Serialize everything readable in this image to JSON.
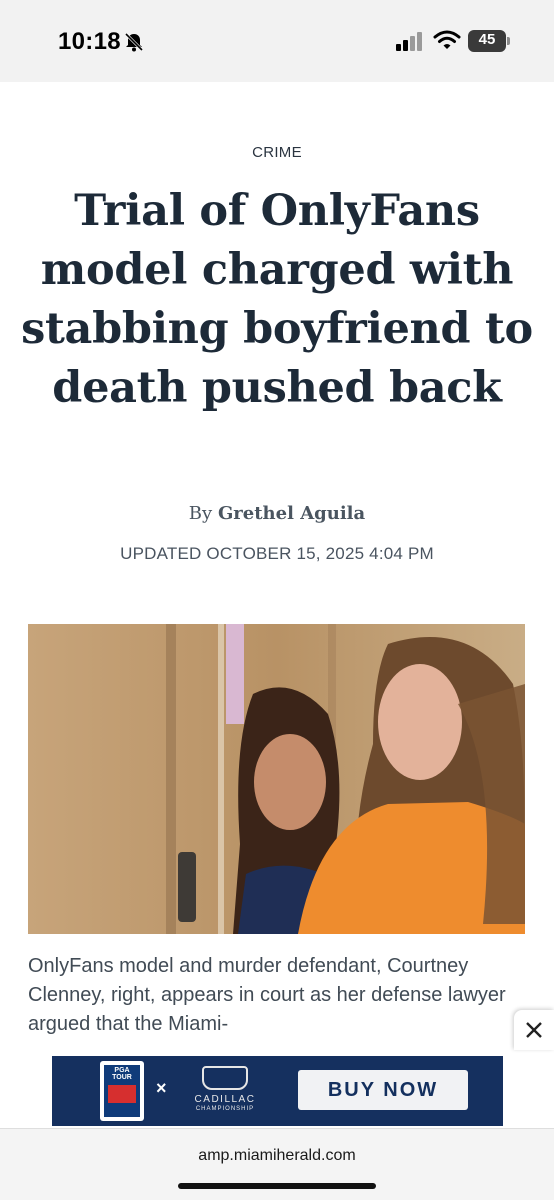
{
  "status_bar": {
    "time": "10:18",
    "battery": "45",
    "icons": [
      "bell-slash-icon",
      "signal-icon",
      "wifi-icon",
      "battery-icon"
    ]
  },
  "article": {
    "section": "CRIME",
    "headline": "Trial of OnlyFans model charged with stabbing boyfriend to death pushed back",
    "byline_prefix": "By",
    "author": "Grethel Aguila",
    "updated": "UPDATED OCTOBER 15, 2025 4:04 PM",
    "caption": "OnlyFans model and murder defendant, Courtney Clenney, right, appears in court as her defense lawyer argued that the Miami-"
  },
  "ad": {
    "close_icon": "close-icon",
    "pga_label": "PGA TOUR",
    "separator": "×",
    "sponsor_line1": "CADILLAC",
    "sponsor_line2": "CHAMPIONSHIP",
    "cta": "BUY NOW",
    "colors": {
      "background": "#15305f",
      "button": "#f1f2f4"
    }
  },
  "browser": {
    "url": "amp.miamiherald.com"
  }
}
